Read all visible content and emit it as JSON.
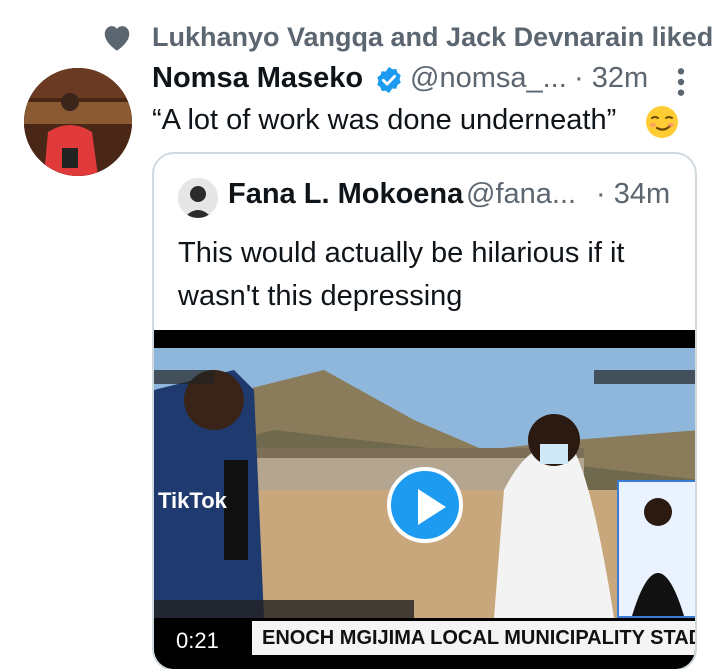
{
  "social_context": {
    "text": "Lukhanyo Vangqa and Jack Devnarain liked",
    "icon": "heart-icon"
  },
  "tweet": {
    "author_name": "Nomsa Maseko",
    "handle": "@nomsa_...",
    "time": "· 32m",
    "text": "“A lot of work was done underneath”",
    "emoji": "smirking-face",
    "verified": true
  },
  "quoted_tweet": {
    "author_name": "Fana L. Mokoena",
    "handle": "@fana...",
    "time": "· 34m",
    "text": "This would actually be hilarious if it wasn't this depressing",
    "video": {
      "duration": "0:21",
      "ticker": "ENOCH MGIJIMA LOCAL MUNICIPALITY STADIUM SAGA",
      "watermark": "TikTok"
    }
  },
  "colors": {
    "accent": "#1d9bf0",
    "secondary_text": "#5b6670",
    "border": "#cfd9de"
  }
}
